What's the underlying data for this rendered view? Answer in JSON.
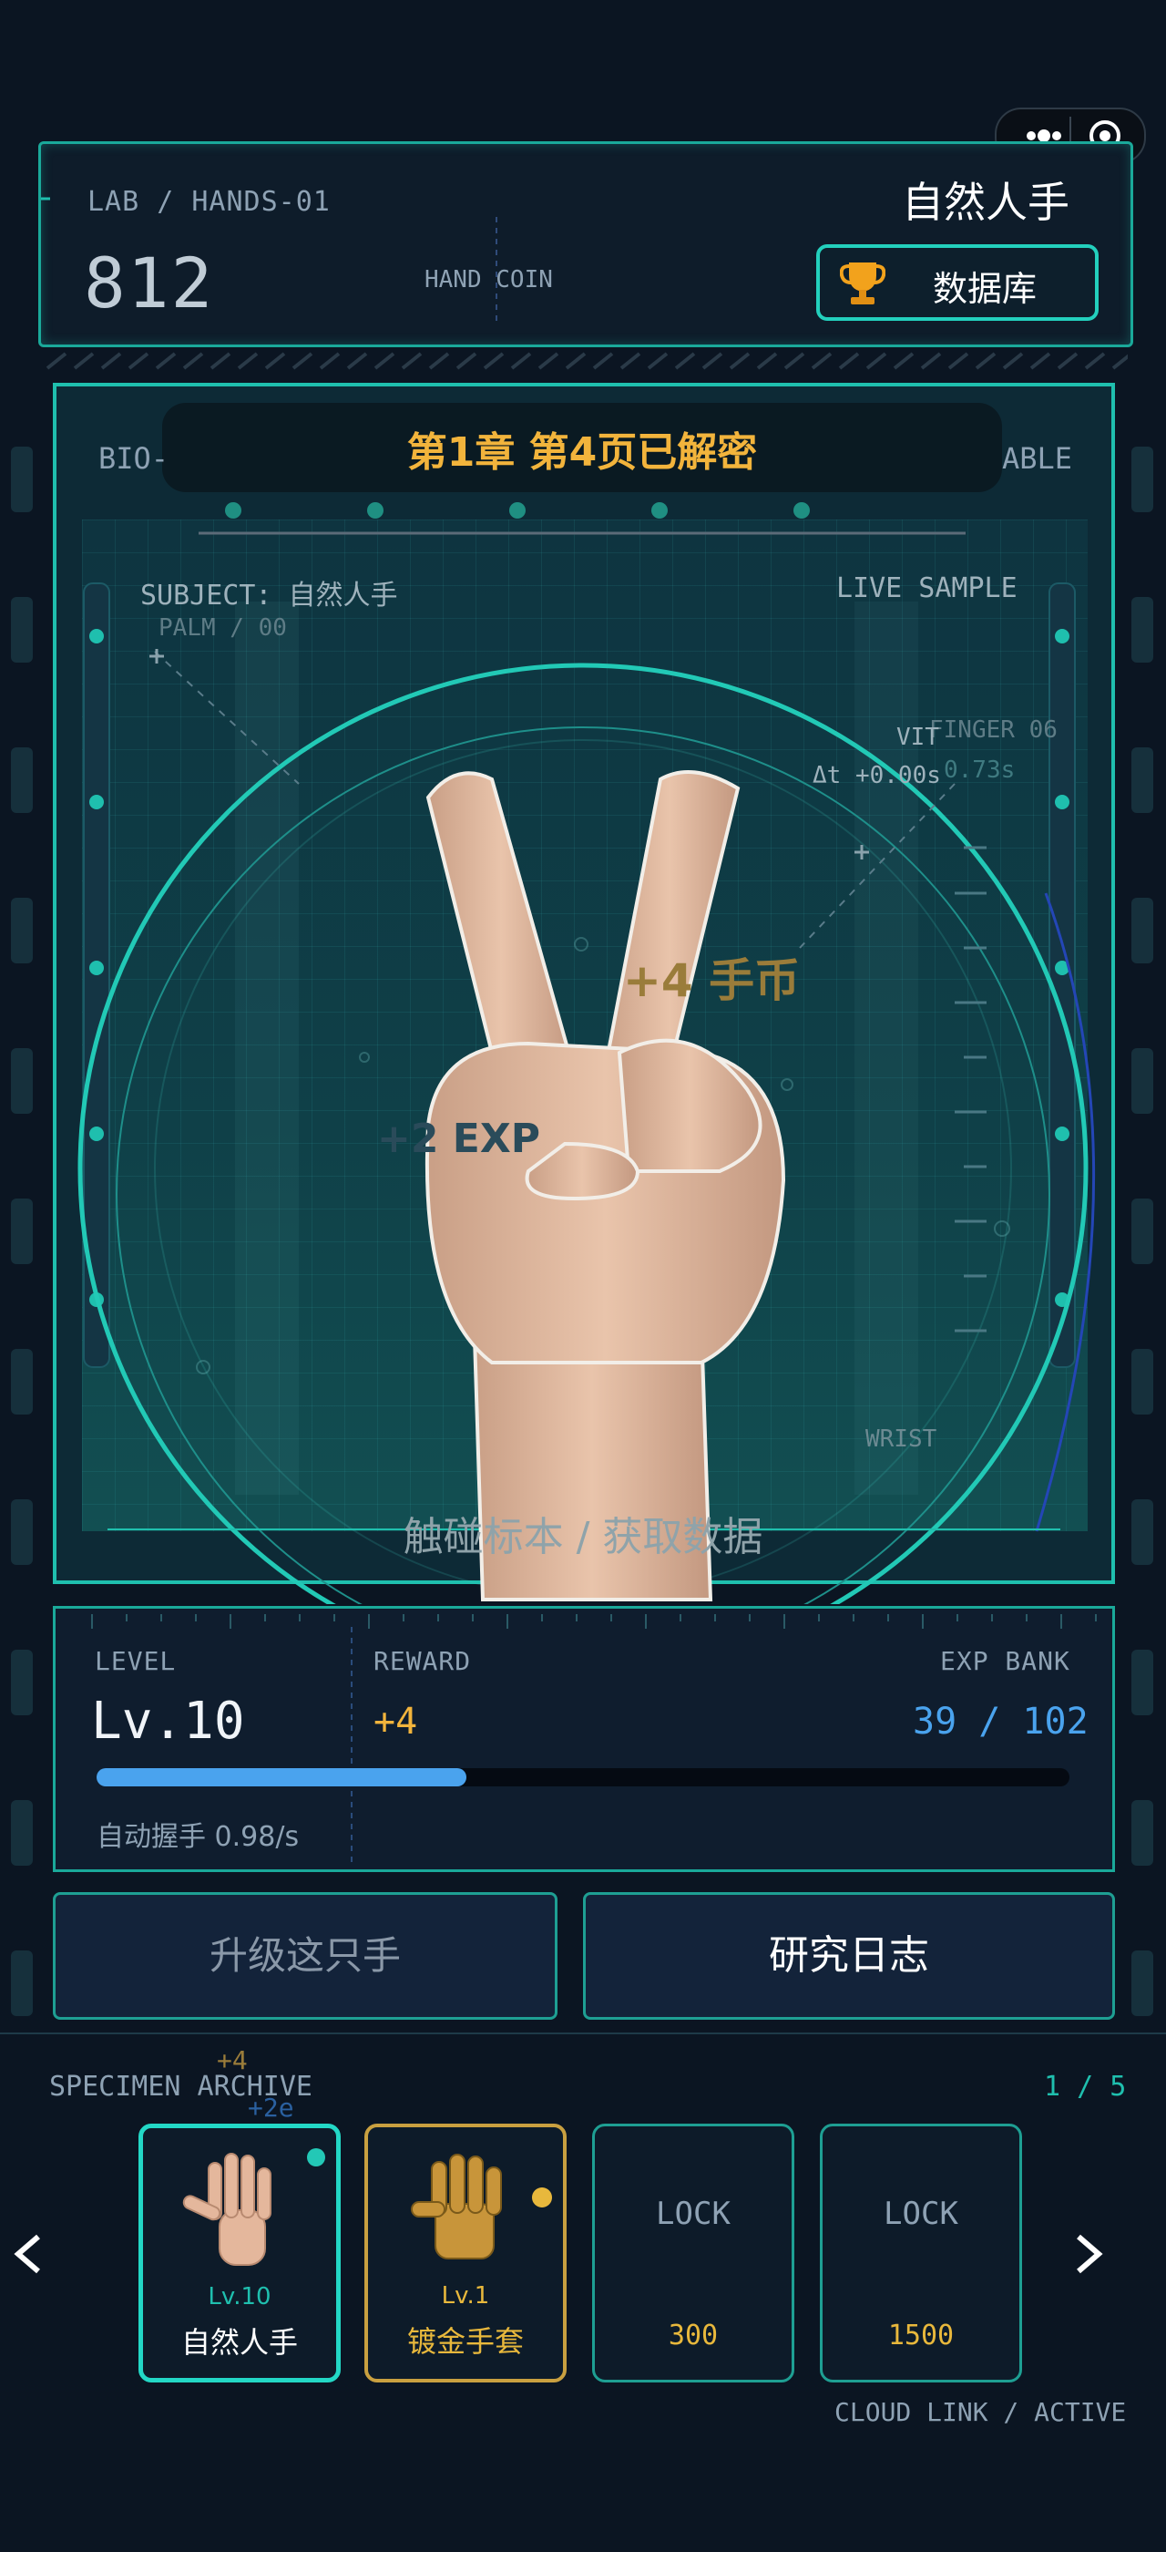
{
  "capsule": {
    "more_icon": "more-dots-icon",
    "close_icon": "target-circle-icon"
  },
  "header": {
    "lab_label": "LAB / HANDS-01",
    "hand_name": "自然人手",
    "coins": "812",
    "coin_label": "HAND COIN",
    "database_button": "数据库",
    "database_icon": "trophy-icon"
  },
  "stage": {
    "banner": "第1章 第4页已解密",
    "left_edge": "BIO-",
    "right_edge": "ABLE",
    "subject": "SUBJECT: 自然人手",
    "live_sample": "LIVE SAMPLE",
    "palm": "PALM / 00",
    "finger": "FINGER 06",
    "vit": "VIT",
    "delta_t": "Δt +0.00s",
    "delta_t2": "0.73s",
    "wrist": "WRIST",
    "float_coin": "+4 手币",
    "float_exp": "+2 EXP",
    "cta": "触碰标本 / 获取数据"
  },
  "stats": {
    "level_label": "LEVEL",
    "level_value": "Lv.10",
    "reward_label": "REWARD",
    "reward_value": "+4",
    "exp_label": "EXP BANK",
    "exp_value": "39 / 102",
    "exp_progress": 0.38,
    "auto_grip": "自动握手 0.98/s"
  },
  "actions": {
    "upgrade": "升级这只手",
    "journal": "研究日志"
  },
  "archive": {
    "title": "SPECIMEN ARCHIVE",
    "float_plus4": "+4",
    "float_plus2e": "+2e",
    "page": "1 / 5",
    "cards": [
      {
        "level": "Lv.10",
        "name": "自然人手"
      },
      {
        "level": "Lv.1",
        "name": "镀金手套"
      },
      {
        "lock": "LOCK",
        "cost": "300"
      },
      {
        "lock": "LOCK",
        "cost": "1500"
      }
    ],
    "footer": "CLOUD LINK / ACTIVE"
  },
  "colors": {
    "teal": "#1fbfae",
    "gold": "#f2b43c",
    "blue": "#4aa3ee",
    "bg": "#0b1522"
  }
}
